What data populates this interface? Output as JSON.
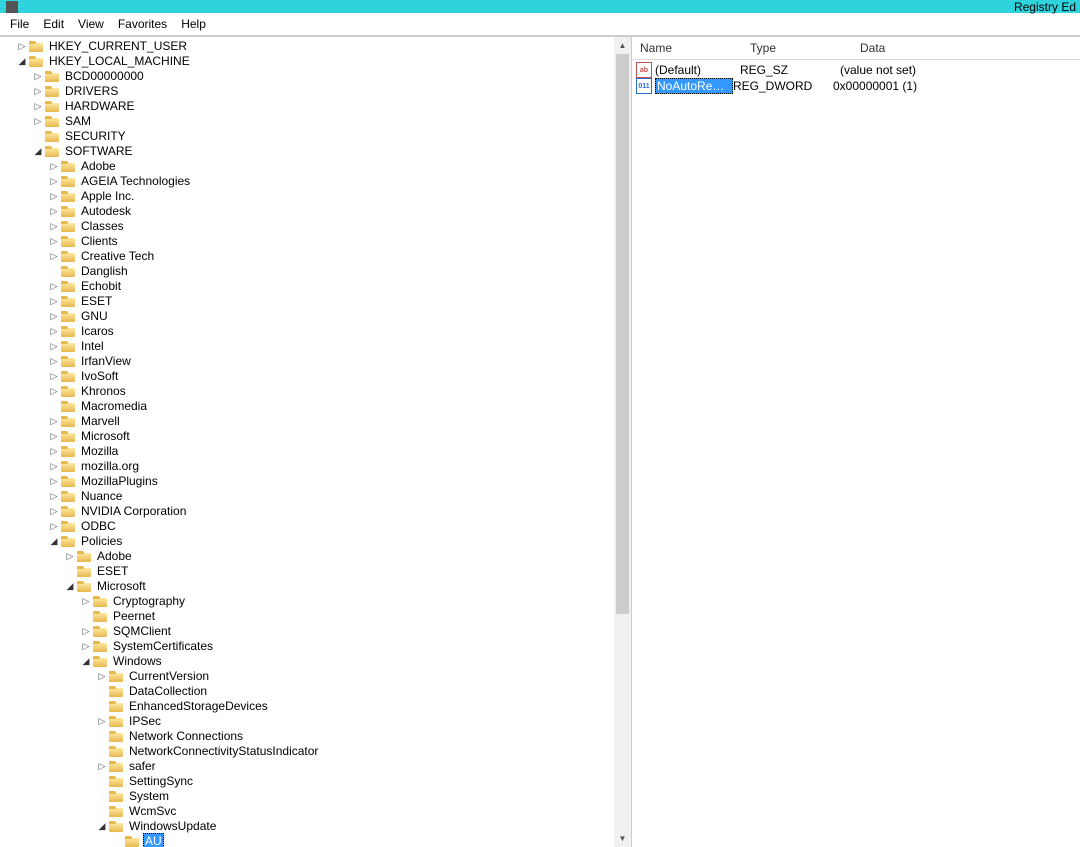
{
  "window": {
    "title": "Registry Ed"
  },
  "menus": {
    "file": "File",
    "edit": "Edit",
    "view": "View",
    "favorites": "Favorites",
    "help": "Help"
  },
  "columns": {
    "name": "Name",
    "type": "Type",
    "data": "Data"
  },
  "values": [
    {
      "icon": "sz",
      "name": "(Default)",
      "type": "REG_SZ",
      "data": "(value not set)",
      "selected": false
    },
    {
      "icon": "dw",
      "name": "NoAutoReboot...",
      "type": "REG_DWORD",
      "data": "0x00000001 (1)",
      "selected": true
    }
  ],
  "tree": [
    {
      "i": 1,
      "e": "closed",
      "label": "HKEY_CURRENT_USER"
    },
    {
      "i": 1,
      "e": "open",
      "label": "HKEY_LOCAL_MACHINE"
    },
    {
      "i": 2,
      "e": "closed",
      "label": "BCD00000000"
    },
    {
      "i": 2,
      "e": "closed",
      "label": "DRIVERS"
    },
    {
      "i": 2,
      "e": "closed",
      "label": "HARDWARE"
    },
    {
      "i": 2,
      "e": "closed",
      "label": "SAM"
    },
    {
      "i": 2,
      "e": "none",
      "label": "SECURITY"
    },
    {
      "i": 2,
      "e": "open",
      "label": "SOFTWARE"
    },
    {
      "i": 3,
      "e": "closed",
      "label": "Adobe"
    },
    {
      "i": 3,
      "e": "closed",
      "label": "AGEIA Technologies"
    },
    {
      "i": 3,
      "e": "closed",
      "label": "Apple Inc."
    },
    {
      "i": 3,
      "e": "closed",
      "label": "Autodesk"
    },
    {
      "i": 3,
      "e": "closed",
      "label": "Classes"
    },
    {
      "i": 3,
      "e": "closed",
      "label": "Clients"
    },
    {
      "i": 3,
      "e": "closed",
      "label": "Creative Tech"
    },
    {
      "i": 3,
      "e": "none",
      "label": "Danglish"
    },
    {
      "i": 3,
      "e": "closed",
      "label": "Echobit"
    },
    {
      "i": 3,
      "e": "closed",
      "label": "ESET"
    },
    {
      "i": 3,
      "e": "closed",
      "label": "GNU"
    },
    {
      "i": 3,
      "e": "closed",
      "label": "Icaros"
    },
    {
      "i": 3,
      "e": "closed",
      "label": "Intel"
    },
    {
      "i": 3,
      "e": "closed",
      "label": "IrfanView"
    },
    {
      "i": 3,
      "e": "closed",
      "label": "IvoSoft"
    },
    {
      "i": 3,
      "e": "closed",
      "label": "Khronos"
    },
    {
      "i": 3,
      "e": "none",
      "label": "Macromedia"
    },
    {
      "i": 3,
      "e": "closed",
      "label": "Marvell"
    },
    {
      "i": 3,
      "e": "closed",
      "label": "Microsoft"
    },
    {
      "i": 3,
      "e": "closed",
      "label": "Mozilla"
    },
    {
      "i": 3,
      "e": "closed",
      "label": "mozilla.org"
    },
    {
      "i": 3,
      "e": "closed",
      "label": "MozillaPlugins"
    },
    {
      "i": 3,
      "e": "closed",
      "label": "Nuance"
    },
    {
      "i": 3,
      "e": "closed",
      "label": "NVIDIA Corporation"
    },
    {
      "i": 3,
      "e": "closed",
      "label": "ODBC"
    },
    {
      "i": 3,
      "e": "open",
      "label": "Policies"
    },
    {
      "i": 4,
      "e": "closed",
      "label": "Adobe"
    },
    {
      "i": 4,
      "e": "none",
      "label": "ESET"
    },
    {
      "i": 4,
      "e": "open",
      "label": "Microsoft"
    },
    {
      "i": 5,
      "e": "closed",
      "label": "Cryptography"
    },
    {
      "i": 5,
      "e": "none",
      "label": "Peernet"
    },
    {
      "i": 5,
      "e": "closed",
      "label": "SQMClient"
    },
    {
      "i": 5,
      "e": "closed",
      "label": "SystemCertificates"
    },
    {
      "i": 5,
      "e": "open",
      "label": "Windows"
    },
    {
      "i": 6,
      "e": "closed",
      "label": "CurrentVersion"
    },
    {
      "i": 6,
      "e": "none",
      "label": "DataCollection"
    },
    {
      "i": 6,
      "e": "none",
      "label": "EnhancedStorageDevices"
    },
    {
      "i": 6,
      "e": "closed",
      "label": "IPSec"
    },
    {
      "i": 6,
      "e": "none",
      "label": "Network Connections"
    },
    {
      "i": 6,
      "e": "none",
      "label": "NetworkConnectivityStatusIndicator"
    },
    {
      "i": 6,
      "e": "closed",
      "label": "safer"
    },
    {
      "i": 6,
      "e": "none",
      "label": "SettingSync"
    },
    {
      "i": 6,
      "e": "none",
      "label": "System"
    },
    {
      "i": 6,
      "e": "none",
      "label": "WcmSvc"
    },
    {
      "i": 6,
      "e": "open",
      "label": "WindowsUpdate"
    },
    {
      "i": 7,
      "e": "none",
      "label": "AU",
      "selected": true
    }
  ]
}
